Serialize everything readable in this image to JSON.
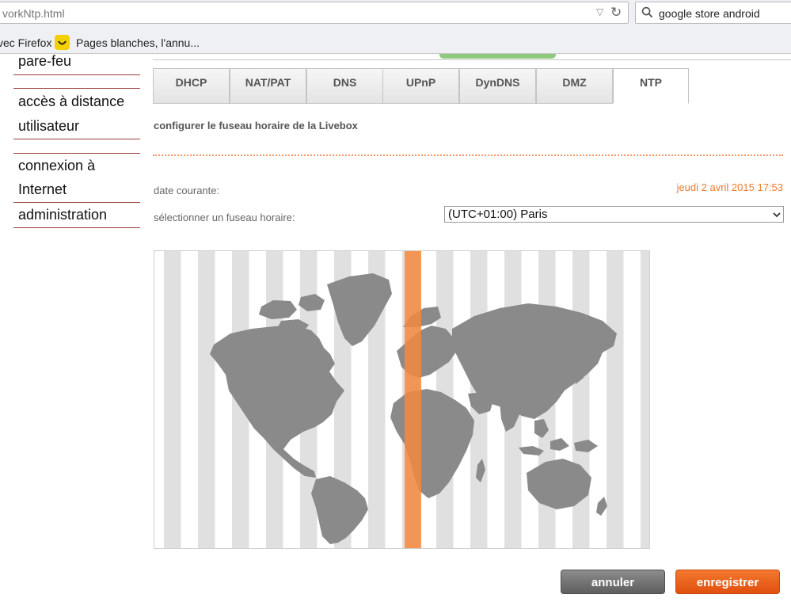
{
  "browser": {
    "url": "vorkNtp.html",
    "search_query": "google store android",
    "bookmarks": [
      "vec Firefox",
      "Pages blanches, l'annu..."
    ]
  },
  "sidebar": {
    "items": [
      {
        "label": "pare-feu"
      },
      {
        "label": "accès à distance"
      },
      {
        "label": "utilisateur"
      },
      {
        "label": "connexion à"
      },
      {
        "label": "Internet"
      },
      {
        "label": "administration"
      }
    ]
  },
  "tabs": [
    {
      "label": "DHCP"
    },
    {
      "label": "NAT/PAT"
    },
    {
      "label": "DNS"
    },
    {
      "label": "UPnP"
    },
    {
      "label": "DynDNS"
    },
    {
      "label": "DMZ"
    },
    {
      "label": "NTP"
    }
  ],
  "active_tab": "NTP",
  "section": {
    "title": "configurer le fuseau horaire de la Livebox"
  },
  "date": {
    "label": "date courante:",
    "value": "jeudi 2 avril 2015 17:53"
  },
  "timezone": {
    "label": "sélectionner un fuseau horaire:",
    "selected": "(UTC+01:00) Paris"
  },
  "actions": {
    "cancel": "annuler",
    "save": "enregistrer"
  },
  "colors": {
    "accent": "#ee7a2c",
    "highlight_zone": "#f5883e",
    "map_land": "#8a8a8a",
    "zone_stripe": "#e0e0e0",
    "sidebar_rule": "#9c3b3b"
  },
  "icons": {
    "reload": "reload-icon",
    "search": "search-icon",
    "dropdown": "chevron-down-icon",
    "bookmark": "smiley-icon"
  }
}
